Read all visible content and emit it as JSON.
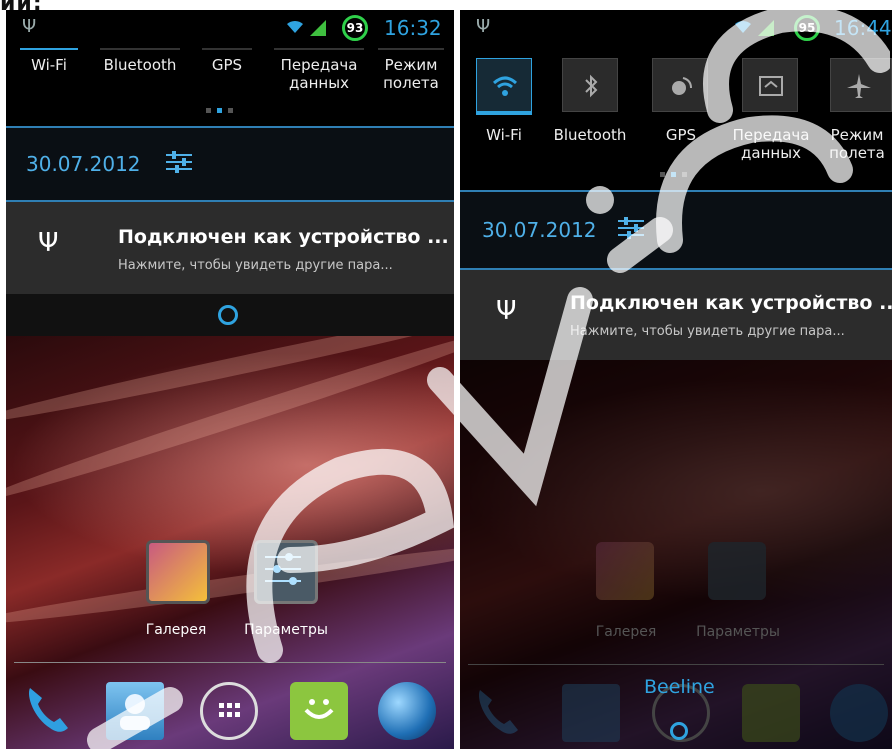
{
  "left": {
    "status": {
      "battery": "93",
      "time": "16:32"
    },
    "toggles": [
      {
        "label": "Wi-Fi",
        "on": true
      },
      {
        "label": "Bluetooth",
        "on": false
      },
      {
        "label": "GPS",
        "on": false
      },
      {
        "label": "Передача\nданных",
        "on": false
      },
      {
        "label": "Режим\nполета",
        "on": false
      }
    ],
    "date": "30.07.2012",
    "notification": {
      "title": "Подключен как устройство ...",
      "text": "Нажмите, чтобы увидеть другие пара..."
    },
    "home": {
      "apps": [
        {
          "label": "Галерея"
        },
        {
          "label": "Параметры"
        }
      ]
    }
  },
  "right": {
    "status": {
      "battery": "95",
      "time": "16:44"
    },
    "toggles": [
      {
        "label": "Wi-Fi",
        "on": true
      },
      {
        "label": "Bluetooth",
        "on": false
      },
      {
        "label": "GPS",
        "on": false
      },
      {
        "label": "Передача\nданных",
        "on": false
      },
      {
        "label": "Режим\nполета",
        "on": false
      }
    ],
    "date": "30.07.2012",
    "notification": {
      "title": "Подключен как устройство ...",
      "text": "Нажмите, чтобы увидеть другие пара..."
    },
    "home": {
      "apps": [
        {
          "label": "Галерея"
        },
        {
          "label": "Параметры"
        }
      ]
    },
    "carrier": "Beeline"
  },
  "colors": {
    "accent": "#2fa3e0",
    "battery": "#2fd04a",
    "watermark": "#ffffff"
  }
}
